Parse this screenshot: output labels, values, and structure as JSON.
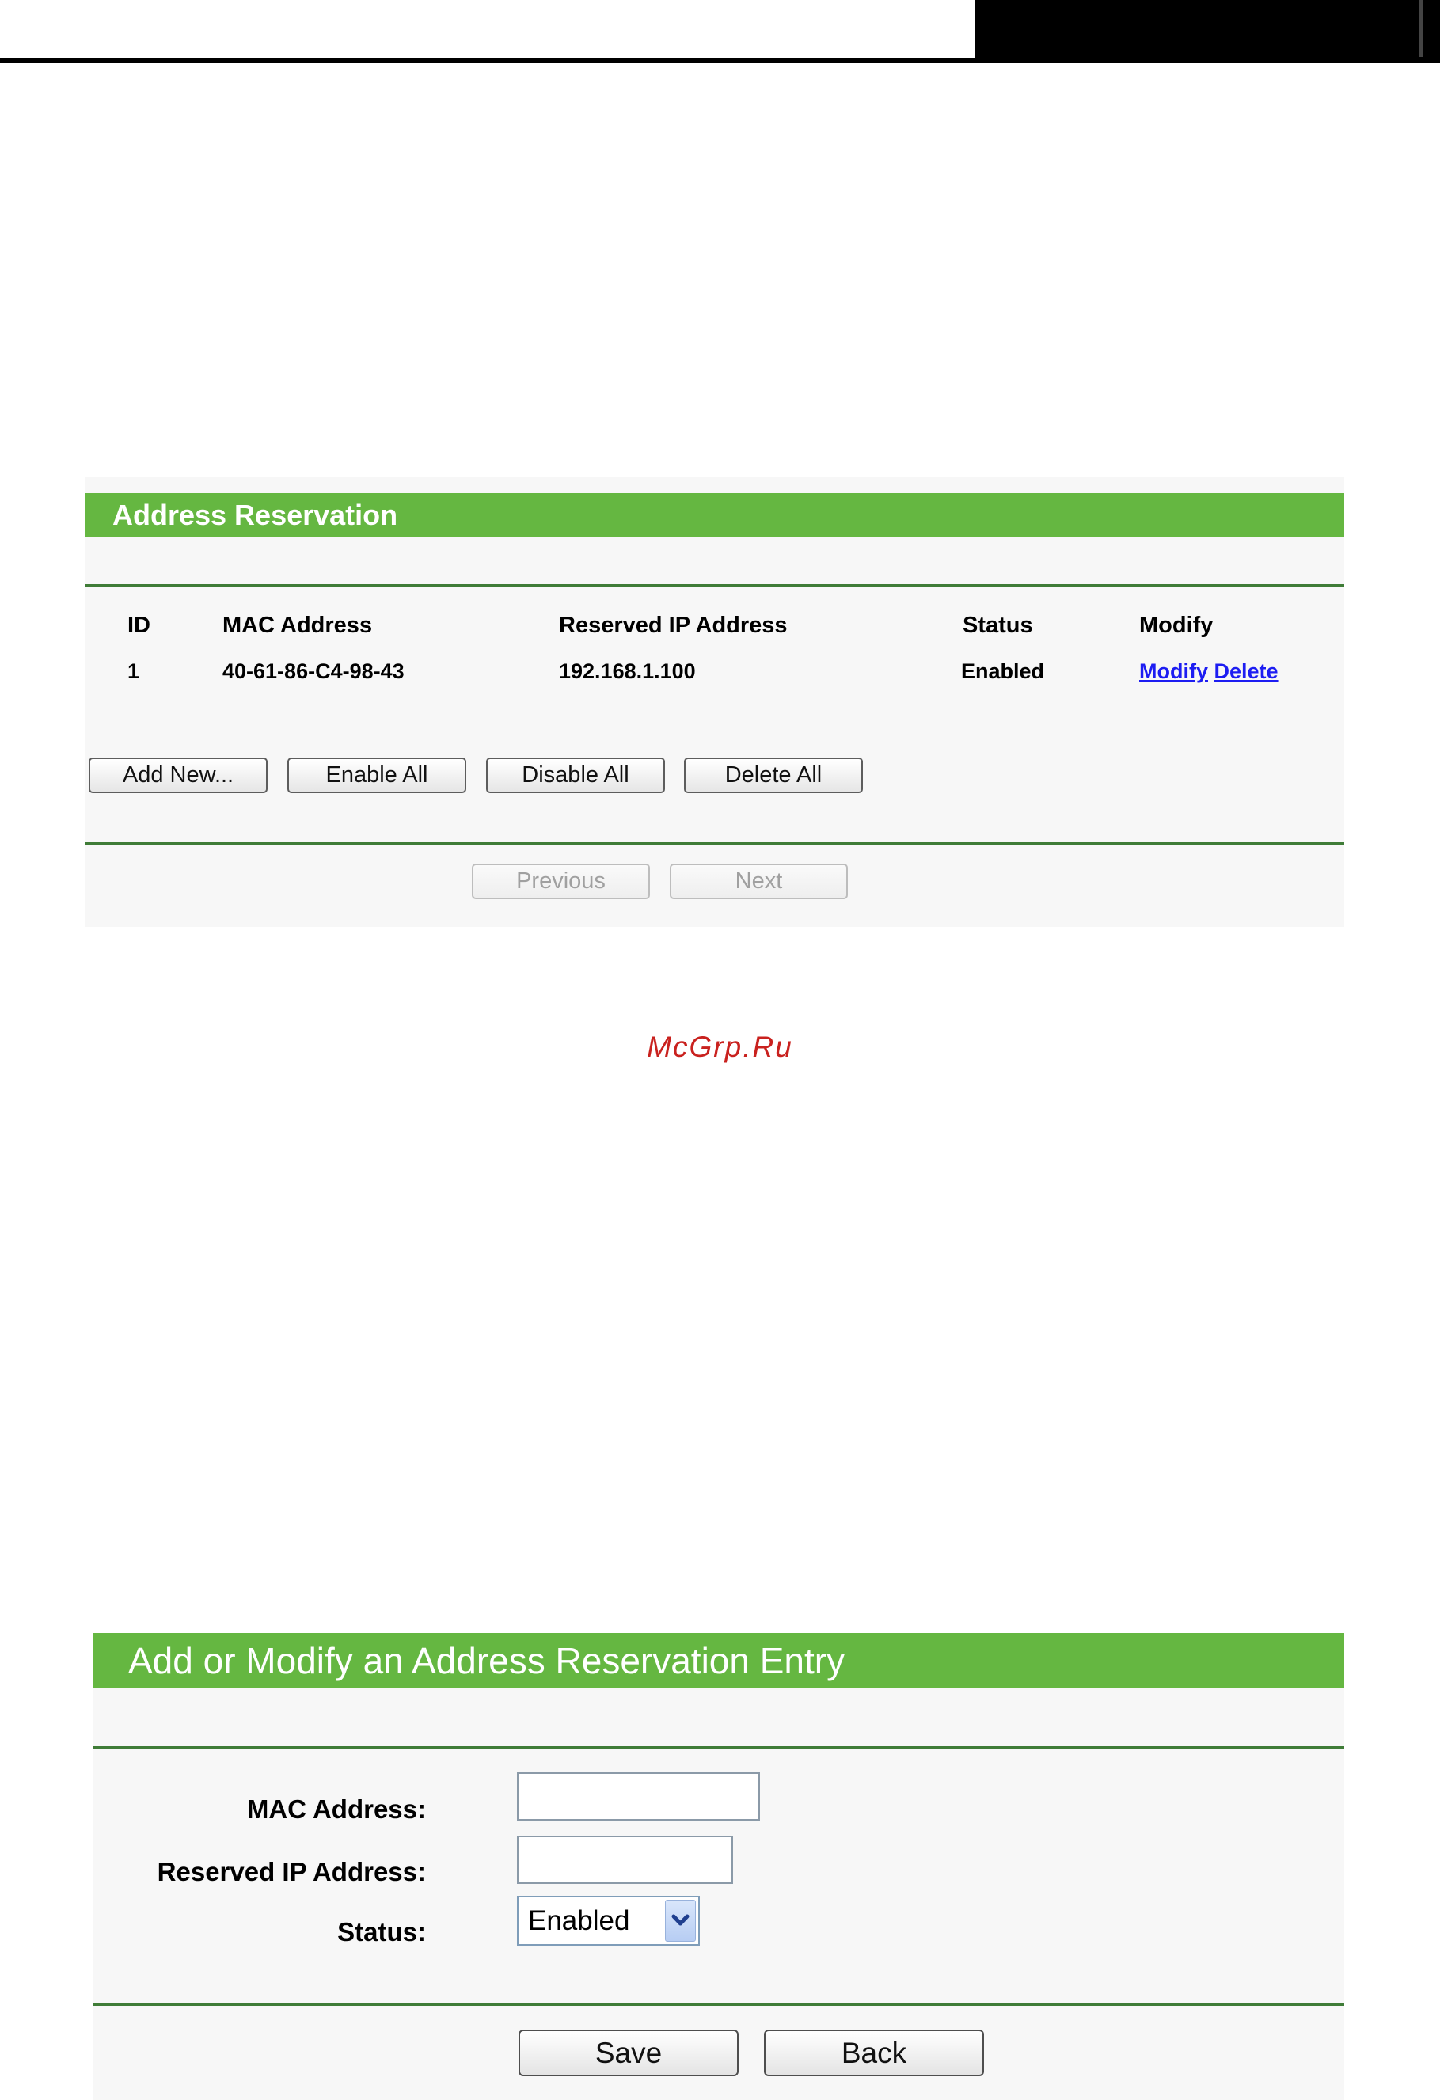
{
  "reservation_panel": {
    "title": "Address Reservation",
    "columns": [
      "ID",
      "MAC Address",
      "Reserved IP Address",
      "Status",
      "Modify"
    ],
    "rows": [
      {
        "id": "1",
        "mac": "40-61-86-C4-98-43",
        "ip": "192.168.1.100",
        "status": "Enabled",
        "modify_link": "Modify",
        "delete_link": "Delete"
      }
    ],
    "buttons": {
      "add_new": "Add New...",
      "enable_all": "Enable All",
      "disable_all": "Disable All",
      "delete_all": "Delete All"
    },
    "pagination": {
      "previous": "Previous",
      "next": "Next"
    }
  },
  "watermark": "McGrp.Ru",
  "entry_panel": {
    "title": "Add or Modify an Address Reservation Entry",
    "fields": {
      "mac_label": "MAC Address:",
      "mac_value": "",
      "ip_label": "Reserved IP Address:",
      "ip_value": "",
      "status_label": "Status:",
      "status_value": "Enabled"
    },
    "buttons": {
      "save": "Save",
      "back": "Back"
    }
  },
  "colors": {
    "header_green": "#65b741",
    "rule_green": "#3f7c37",
    "link_blue": "#1d1df2",
    "watermark_red": "#c9211e"
  },
  "icons": {
    "dropdown": "chevron-down-icon"
  }
}
